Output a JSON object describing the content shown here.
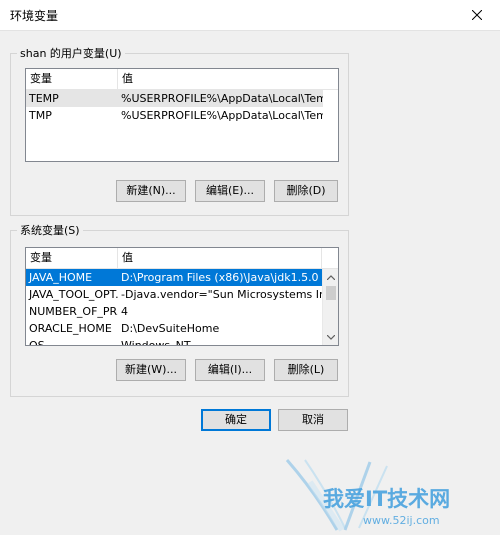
{
  "window": {
    "title": "环境变量",
    "close_icon": "close-icon"
  },
  "user_vars": {
    "group_label": "shan 的用户变量(U)",
    "columns": [
      "变量",
      "值"
    ],
    "rows": [
      {
        "name": "TEMP",
        "value": "%USERPROFILE%\\AppData\\Local\\Temp",
        "state": "selected-inactive"
      },
      {
        "name": "TMP",
        "value": "%USERPROFILE%\\AppData\\Local\\Temp",
        "state": "normal"
      }
    ],
    "buttons": {
      "new": "新建(N)...",
      "edit": "编辑(E)...",
      "delete": "删除(D)"
    }
  },
  "system_vars": {
    "group_label": "系统变量(S)",
    "columns": [
      "变量",
      "值"
    ],
    "rows": [
      {
        "name": "JAVA_HOME",
        "value": "D:\\Program Files (x86)\\Java\\jdk1.5.0",
        "state": "selected"
      },
      {
        "name": "JAVA_TOOL_OPT...",
        "value": "-Djava.vendor=\"Sun Microsystems Inc.\"",
        "state": "normal"
      },
      {
        "name": "NUMBER_OF_PR...",
        "value": "4",
        "state": "normal"
      },
      {
        "name": "ORACLE_HOME",
        "value": "D:\\DevSuiteHome",
        "state": "normal"
      },
      {
        "name": "OS",
        "value": "Windows_NT",
        "state": "partial"
      }
    ],
    "buttons": {
      "new": "新建(W)...",
      "edit": "编辑(I)...",
      "delete": "删除(L)"
    },
    "scroll_position": 0
  },
  "dialog_buttons": {
    "ok": "确定",
    "cancel": "取消"
  },
  "watermark": {
    "main": "我爱IT技术网",
    "url": "www.52ij.com"
  },
  "colors": {
    "selection_blue": "#0078d7",
    "selection_gray": "#e5e5e5",
    "dialog_bg": "#f0f0f0"
  }
}
